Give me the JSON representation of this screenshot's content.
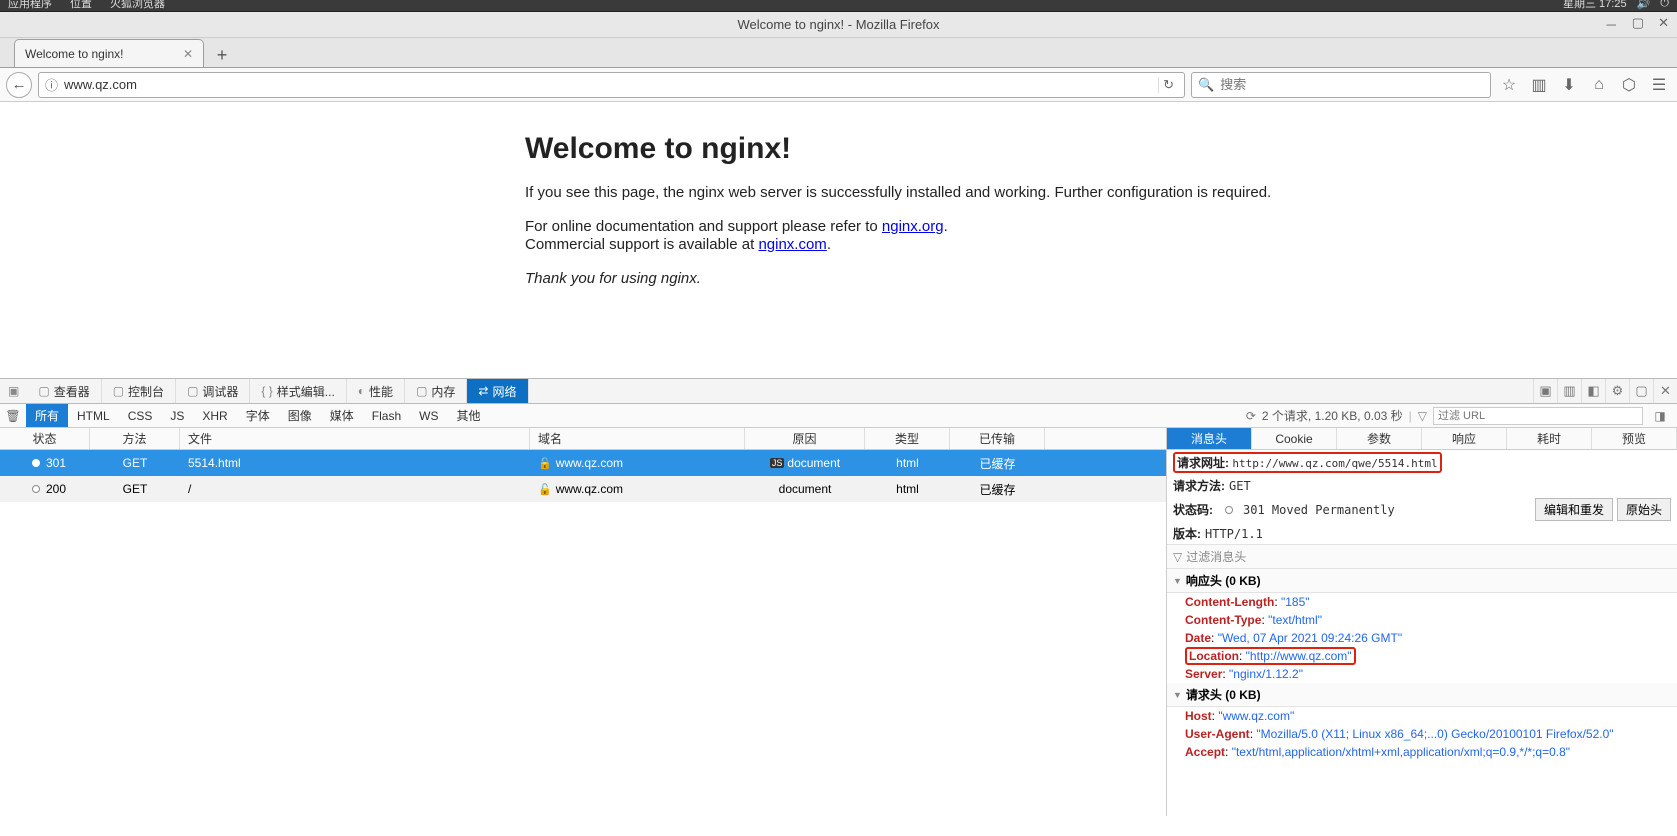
{
  "os": {
    "menu": [
      "应用程序",
      "位置",
      "火狐浏览器"
    ],
    "clock": "星期三 17:25"
  },
  "window": {
    "title": "Welcome to nginx! - Mozilla Firefox"
  },
  "tab": {
    "title": "Welcome to nginx!"
  },
  "url": "www.qz.com",
  "search_placeholder": "搜索",
  "page": {
    "h1": "Welcome to nginx!",
    "p1": "If you see this page, the nginx web server is successfully installed and working. Further configuration is required.",
    "p2a": "For online documentation and support please refer to ",
    "p2link1": "nginx.org",
    "p2b": ".\nCommercial support is available at ",
    "p2link2": "nginx.com",
    "p2c": ".",
    "thanks": "Thank you for using nginx."
  },
  "devtools": {
    "panels": [
      "查看器",
      "控制台",
      "调试器",
      "样式编辑...",
      "性能",
      "内存",
      "网络"
    ],
    "active_panel": "网络",
    "filters": [
      "所有",
      "HTML",
      "CSS",
      "JS",
      "XHR",
      "字体",
      "图像",
      "媒体",
      "Flash",
      "WS",
      "其他"
    ],
    "active_filter": "所有",
    "summary": "2 个请求, 1.20 KB, 0.03 秒",
    "filter_placeholder": "过滤 URL"
  },
  "network": {
    "columns": [
      "状态",
      "方法",
      "文件",
      "域名",
      "原因",
      "类型",
      "已传输"
    ],
    "rows": [
      {
        "status": "301",
        "method": "GET",
        "file": "5514.html",
        "domain": "www.qz.com",
        "cause": "document",
        "cause_badge": "JS",
        "type": "html",
        "transferred": "已缓存",
        "selected": true
      },
      {
        "status": "200",
        "method": "GET",
        "file": "/",
        "domain": "www.qz.com",
        "cause": "document",
        "type": "html",
        "transferred": "已缓存",
        "selected": false
      }
    ]
  },
  "detail": {
    "tabs": [
      "消息头",
      "Cookie",
      "参数",
      "响应",
      "耗时",
      "预览"
    ],
    "active_tab": "消息头",
    "request_url_label": "请求网址:",
    "request_url": "http://www.qz.com/qwe/5514.html",
    "method_label": "请求方法:",
    "method": "GET",
    "status_label": "状态码:",
    "status": "301 Moved Permanently",
    "version_label": "版本:",
    "version": "HTTP/1.1",
    "edit_resend": "编辑和重发",
    "raw": "原始头",
    "filter_header_placeholder": "过滤消息头",
    "response_section": "响应头 (0 KB)",
    "response_headers": [
      {
        "k": "Content-Length",
        "v": "\"185\""
      },
      {
        "k": "Content-Type",
        "v": "\"text/html\""
      },
      {
        "k": "Date",
        "v": "\"Wed, 07 Apr 2021 09:24:26 GMT\""
      },
      {
        "k": "Location",
        "v": "\"http://www.qz.com\"",
        "boxed": true
      },
      {
        "k": "Server",
        "v": "\"nginx/1.12.2\""
      }
    ],
    "request_section": "请求头 (0 KB)",
    "request_headers": [
      {
        "k": "Host",
        "v": "\"www.qz.com\""
      },
      {
        "k": "User-Agent",
        "v": "\"Mozilla/5.0 (X11; Linux x86_64;...0) Gecko/20100101 Firefox/52.0\""
      },
      {
        "k": "Accept",
        "v": "\"text/html,application/xhtml+xml,application/xml;q=0.9,*/*;q=0.8\""
      }
    ]
  }
}
